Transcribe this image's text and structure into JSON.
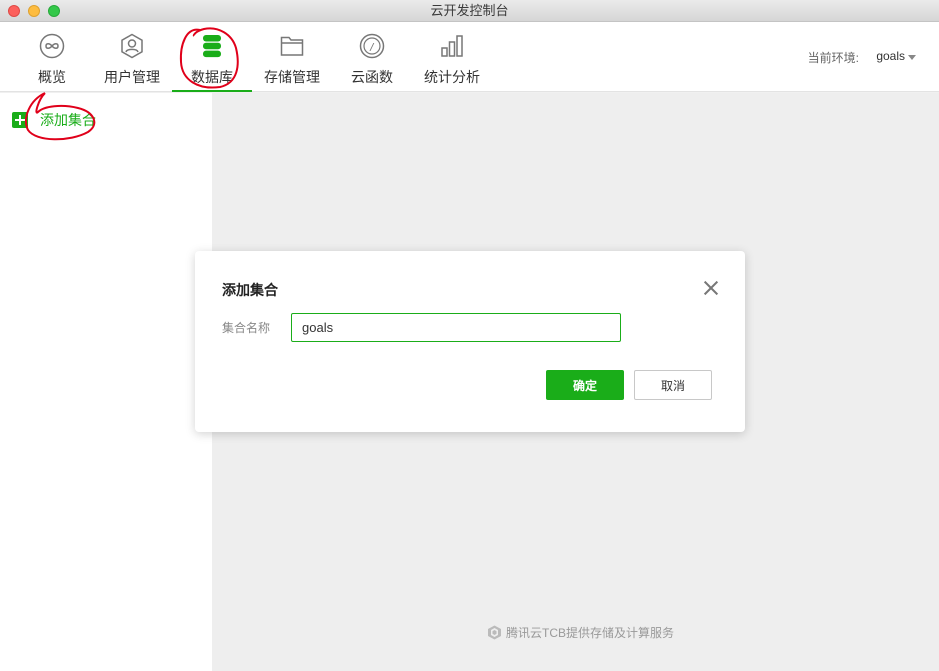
{
  "window": {
    "title": "云开发控制台"
  },
  "nav": {
    "items": [
      {
        "label": "概览",
        "icon": "overview-icon"
      },
      {
        "label": "用户管理",
        "icon": "user-icon"
      },
      {
        "label": "数据库",
        "icon": "database-icon",
        "active": true
      },
      {
        "label": "存储管理",
        "icon": "folder-icon"
      },
      {
        "label": "云函数",
        "icon": "function-icon"
      },
      {
        "label": "统计分析",
        "icon": "chart-icon"
      }
    ]
  },
  "env": {
    "label": "当前环境:",
    "value": "goals"
  },
  "sidebar": {
    "add_collection": "添加集合"
  },
  "dialog": {
    "title": "添加集合",
    "field_label": "集合名称",
    "field_value": "goals",
    "confirm": "确定",
    "cancel": "取消"
  },
  "footer": {
    "text": "腾讯云TCB提供存储及计算服务"
  },
  "colors": {
    "accent": "#1aad19",
    "annotation": "#e0001a"
  }
}
